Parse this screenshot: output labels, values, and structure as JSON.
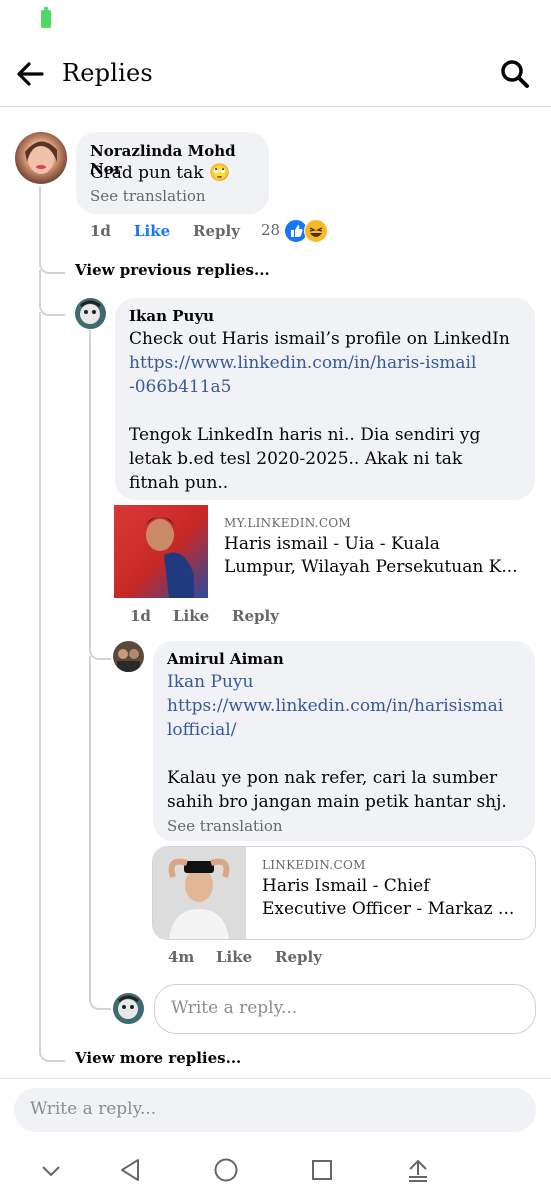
{
  "header": {
    "title": "Replies"
  },
  "comment": {
    "author": "Norazlinda Mohd Nor",
    "text": "Grad pun tak 🙄",
    "see_translation": "See translation",
    "time": "1d",
    "like_label": "Like",
    "reply_label": "Reply",
    "reaction_count": "28"
  },
  "view_previous": "View previous replies...",
  "reply1": {
    "author": "Ikan Puyu",
    "line1": "Check out Haris ismail’s profile on LinkedIn",
    "link1": "https://www.linkedin.com/in/haris-ismail",
    "link2": "-066b411a5",
    "para1": "Tengok LinkedIn haris ni.. Dia sendiri yg",
    "para2": "letak b.ed tesl 2020-2025.. Akak ni tak",
    "para3": "fitnah pun..",
    "preview_domain": "MY.LINKEDIN.COM",
    "preview_title1": "Haris ismail - Uia - Kuala",
    "preview_title2": "Lumpur, Wilayah Persekutuan K...",
    "time": "1d",
    "like_label": "Like",
    "reply_label": "Reply"
  },
  "reply2": {
    "author": "Amirul Aiman",
    "mention": "Ikan Puyu",
    "link1": "https://www.linkedin.com/in/harisismai",
    "link2": "lofficial/",
    "para1": "Kalau ye pon nak refer, cari la sumber",
    "para2": "sahih bro jangan main petik hantar shj.",
    "see_translation": "See translation",
    "preview_domain": "LINKEDIN.COM",
    "preview_title1": "Haris Ismail - Chief",
    "preview_title2": "Executive Officer - Markaz ...",
    "time": "4m",
    "like_label": "Like",
    "reply_label": "Reply"
  },
  "nested_input": {
    "placeholder": "Write a reply..."
  },
  "view_more": "View more replies...",
  "bottom_input": {
    "placeholder": "Write a reply..."
  },
  "colors": {
    "accent": "#1877f2",
    "link": "#385898",
    "bubble": "#f0f2f5",
    "battery": "#4cd964"
  },
  "icons": [
    "back-arrow-icon",
    "search-icon",
    "like-reaction-icon",
    "haha-reaction-icon",
    "chevron-down-icon",
    "nav-back-icon",
    "nav-home-icon",
    "nav-recents-icon",
    "keyboard-hide-icon"
  ]
}
